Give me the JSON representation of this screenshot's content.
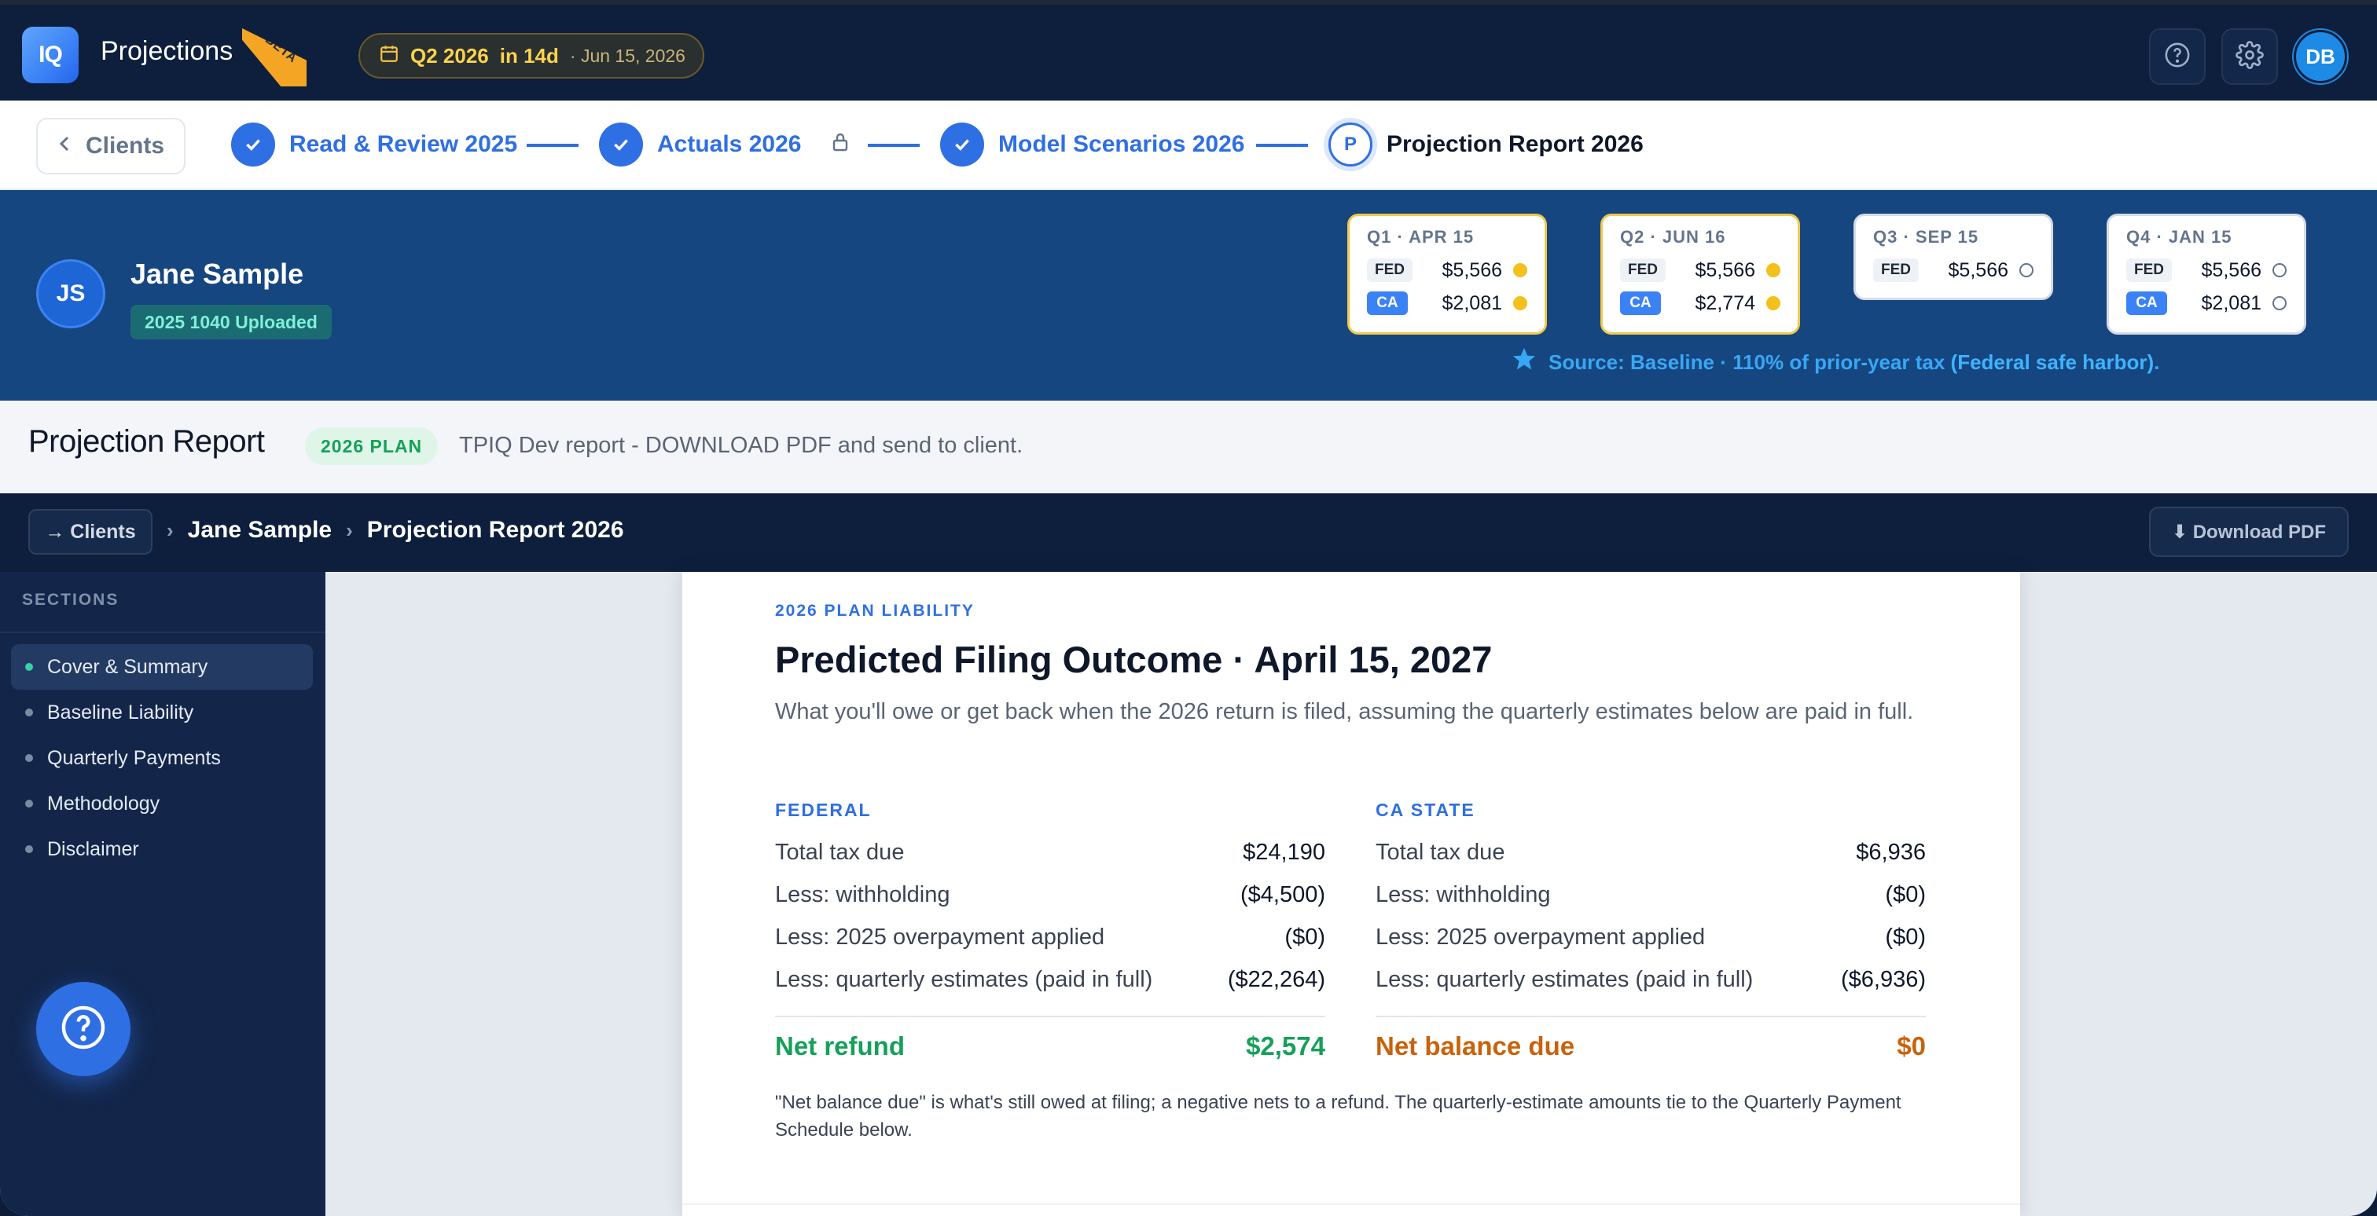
{
  "app": {
    "title": "Projections",
    "beta_label": "BETA",
    "logo_text": "IQ",
    "quarter_pill": {
      "quarter": "Q2 2026",
      "countdown": "in 14d",
      "date": "· Jun 15, 2026"
    },
    "user_initials": "DB"
  },
  "stepper": {
    "back_label": "Clients",
    "steps": [
      {
        "label": "Read & Review 2025",
        "state": "done"
      },
      {
        "label": "Actuals 2026",
        "state": "done",
        "locked": true
      },
      {
        "label": "Model Scenarios 2026",
        "state": "done"
      },
      {
        "label": "Projection Report 2026",
        "state": "current",
        "marker": "P"
      }
    ]
  },
  "client": {
    "initials": "JS",
    "name": "Jane Sample",
    "badge": "2025 1040 Uploaded"
  },
  "quarters": [
    {
      "header": "Q1 · APR 15",
      "fed": "$5,566",
      "fed_status": "paid",
      "ca": "$2,081",
      "ca_status": "paid"
    },
    {
      "header": "Q2 · JUN 16",
      "fed": "$5,566",
      "fed_status": "paid",
      "ca": "$2,774",
      "ca_status": "paid"
    },
    {
      "header": "Q3 · SEP 15",
      "fed": "$5,566",
      "fed_status": "open"
    },
    {
      "header": "Q4 · JAN 15",
      "fed": "$5,566",
      "fed_status": "open",
      "ca": "$2,081",
      "ca_status": "open"
    }
  ],
  "tags": {
    "fed": "FED",
    "ca": "CA"
  },
  "source": {
    "text": "Source: Baseline · 110% of prior-year tax ",
    "emphasis": "(Federal safe harbor)",
    "suffix": "."
  },
  "report": {
    "title": "Projection Report",
    "plan_pill": "2026 PLAN",
    "description": "TPIQ Dev report - DOWNLOAD PDF and send to client."
  },
  "nav": {
    "clients_btn": "→ Clients",
    "crumb_client": "Jane Sample",
    "crumb_page": "Projection Report 2026",
    "download": "⬇ Download PDF"
  },
  "sidebar": {
    "header": "SECTIONS",
    "items": [
      {
        "label": "Cover & Summary",
        "active": true
      },
      {
        "label": "Baseline Liability"
      },
      {
        "label": "Quarterly Payments"
      },
      {
        "label": "Methodology"
      },
      {
        "label": "Disclaimer"
      }
    ]
  },
  "outcome": {
    "eyebrow": "2026 PLAN LIABILITY",
    "title": "Predicted Filing Outcome · April 15, 2027",
    "description": "What you'll owe or get back when the 2026 return is filed, assuming the quarterly estimates below are paid in full.",
    "federal": {
      "header": "FEDERAL",
      "rows": [
        {
          "label": "Total tax due",
          "value": "$24,190"
        },
        {
          "label": "Less: withholding",
          "value": "($4,500)"
        },
        {
          "label": "Less: 2025 overpayment applied",
          "value": "($0)"
        },
        {
          "label": "Less: quarterly estimates (paid in full)",
          "value": "($22,264)"
        }
      ],
      "net_label": "Net refund",
      "net_value": "$2,574"
    },
    "state": {
      "header": "CA STATE",
      "rows": [
        {
          "label": "Total tax due",
          "value": "$6,936"
        },
        {
          "label": "Less: withholding",
          "value": "($0)"
        },
        {
          "label": "Less: 2025 overpayment applied",
          "value": "($0)"
        },
        {
          "label": "Less: quarterly estimates (paid in full)",
          "value": "($6,936)"
        }
      ],
      "net_label": "Net balance due",
      "net_value": "$0"
    },
    "footnote": "\"Net balance due\" is what's still owed at filing; a negative nets to a refund. The quarterly-estimate amounts tie to the Quarterly Payment Schedule below."
  },
  "colors": {
    "accent": "#2f6fe4",
    "topbar": "#0d1f3c",
    "banner": "#16467f",
    "refund": "#16a05a",
    "due": "#c9620a",
    "paid_dot": "#f3c01c"
  }
}
